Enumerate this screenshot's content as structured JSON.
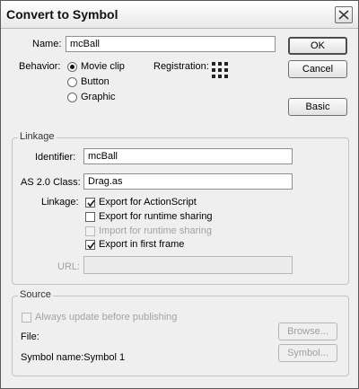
{
  "window": {
    "title": "Convert to Symbol",
    "close_icon": "close-icon"
  },
  "name": {
    "label": "Name:",
    "value": "mcBall"
  },
  "behavior": {
    "label": "Behavior:",
    "options": [
      "Movie clip",
      "Button",
      "Graphic"
    ],
    "selected": "Movie clip"
  },
  "registration": {
    "label": "Registration:",
    "icon": "registration-grid-icon"
  },
  "buttons": {
    "ok": "OK",
    "cancel": "Cancel",
    "basic": "Basic"
  },
  "linkage": {
    "group_label": "Linkage",
    "identifier_label": "Identifier:",
    "identifier_value": "mcBall",
    "class_label": "AS 2.0 Class:",
    "class_value": "Drag.as",
    "linkage_label": "Linkage:",
    "export_actionscript": {
      "label": "Export for ActionScript",
      "checked": true
    },
    "export_runtime": {
      "label": "Export for runtime sharing",
      "checked": false
    },
    "import_runtime": {
      "label": "Import for runtime sharing",
      "checked": false,
      "disabled": true
    },
    "export_first_frame": {
      "label": "Export in first frame",
      "checked": true
    },
    "url_label": "URL:",
    "url_value": ""
  },
  "source": {
    "group_label": "Source",
    "always_update": {
      "label": "Always update before publishing",
      "checked": false,
      "disabled": true
    },
    "file_label": "File:",
    "symbol_name": "Symbol name:Symbol 1",
    "browse_button": "Browse...",
    "symbol_button": "Symbol..."
  }
}
